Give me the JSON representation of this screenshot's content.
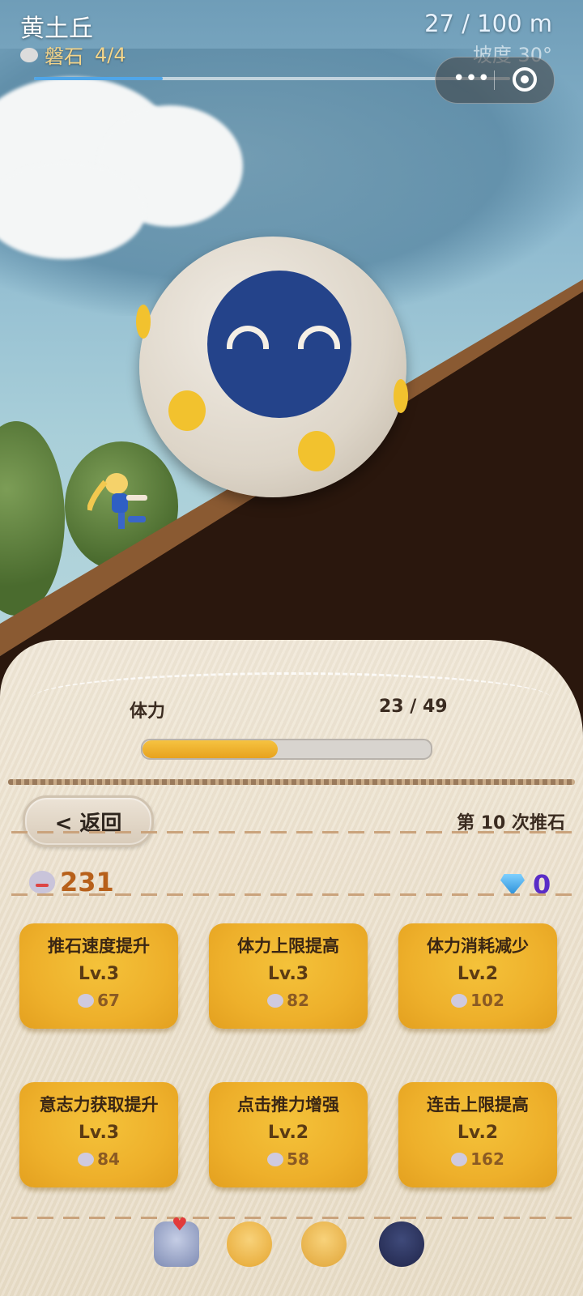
{
  "header": {
    "level_name": "黄土丘",
    "stone_label": "磐石",
    "stone_count": "4/4",
    "distance": "27 / 100 m",
    "slope": "坡度 30°",
    "distance_progress": 0.27
  },
  "menu_capsule": {
    "more_glyph": "•••"
  },
  "stamina": {
    "label": "体力",
    "value": "23 / 49",
    "fraction": 0.4694
  },
  "nav": {
    "back_label": "< 返回",
    "push_count": "第 10 次推石"
  },
  "currency": {
    "willpower": "231",
    "gems": "0"
  },
  "upgrades": [
    {
      "name": "推石速度提升",
      "level": "Lv.3",
      "cost": "67"
    },
    {
      "name": "体力上限提高",
      "level": "Lv.3",
      "cost": "82"
    },
    {
      "name": "体力消耗减少",
      "level": "Lv.2",
      "cost": "102"
    },
    {
      "name": "意志力获取提升",
      "level": "Lv.3",
      "cost": "84"
    },
    {
      "name": "点击推力增强",
      "level": "Lv.2",
      "cost": "58"
    },
    {
      "name": "连击上限提高",
      "level": "Lv.2",
      "cost": "162"
    }
  ],
  "colors": {
    "accent": "#4fa6e9",
    "card": "#eeb02b",
    "willpower": "#b7601a",
    "gem": "#5a2cc7"
  },
  "icons": [
    "stone-icon",
    "willpower-icon",
    "gem-icon",
    "dock-bag-icon",
    "dock-girl-star-icon",
    "dock-girl-icon",
    "dock-boulder-icon"
  ]
}
